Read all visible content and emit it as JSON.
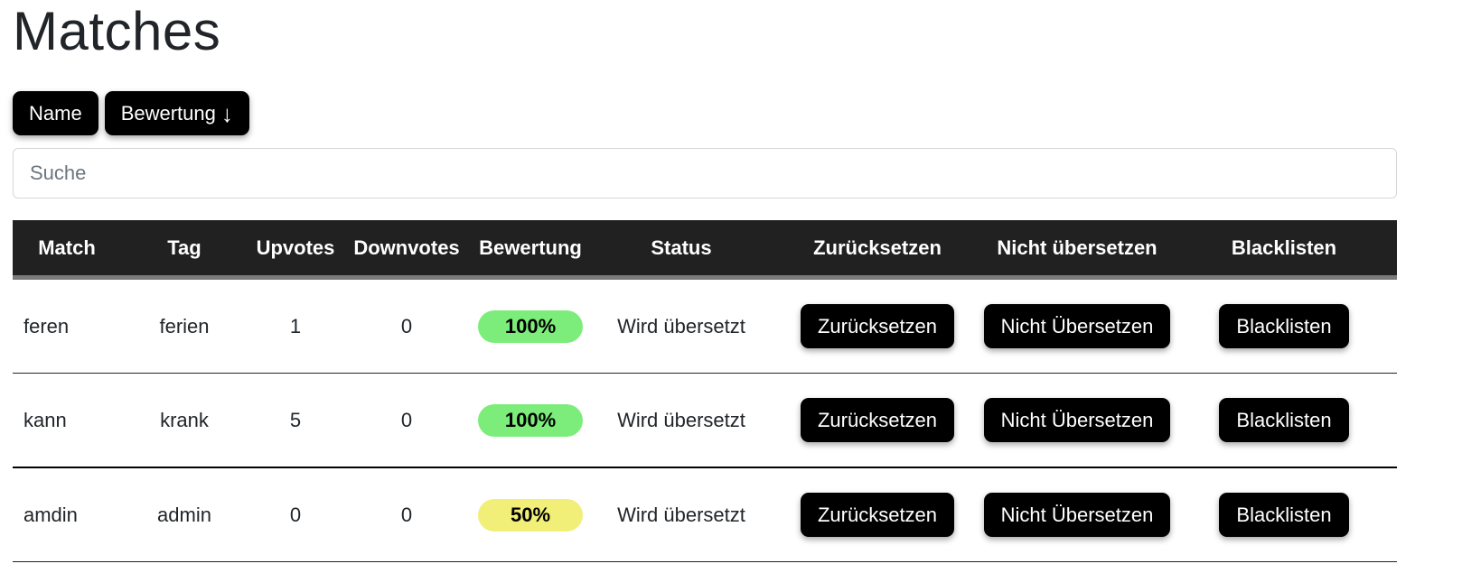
{
  "page": {
    "title": "Matches"
  },
  "sort": {
    "name_label": "Name",
    "rating_label": "Bewertung",
    "rating_arrow": "↓"
  },
  "search": {
    "placeholder": "Suche"
  },
  "table": {
    "headers": {
      "match": "Match",
      "tag": "Tag",
      "upvotes": "Upvotes",
      "downvotes": "Downvotes",
      "rating": "Bewertung",
      "status": "Status",
      "reset": "Zurücksetzen",
      "no_translate": "Nicht übersetzen",
      "blacklist": "Blacklisten"
    },
    "rows": [
      {
        "match": "feren",
        "tag": "ferien",
        "upvotes": "1",
        "downvotes": "0",
        "rating": "100%",
        "rating_color": "#7ced7a",
        "status": "Wird übersetzt",
        "reset_label": "Zurücksetzen",
        "no_translate_label": "Nicht Übersetzen",
        "blacklist_label": "Blacklisten"
      },
      {
        "match": "kann",
        "tag": "krank",
        "upvotes": "5",
        "downvotes": "0",
        "rating": "100%",
        "rating_color": "#7ced7a",
        "status": "Wird übersetzt",
        "reset_label": "Zurücksetzen",
        "no_translate_label": "Nicht Übersetzen",
        "blacklist_label": "Blacklisten"
      },
      {
        "match": "amdin",
        "tag": "admin",
        "upvotes": "0",
        "downvotes": "0",
        "rating": "50%",
        "rating_color": "#f1ef77",
        "status": "Wird übersetzt",
        "reset_label": "Zurücksetzen",
        "no_translate_label": "Nicht Übersetzen",
        "blacklist_label": "Blacklisten"
      }
    ]
  }
}
